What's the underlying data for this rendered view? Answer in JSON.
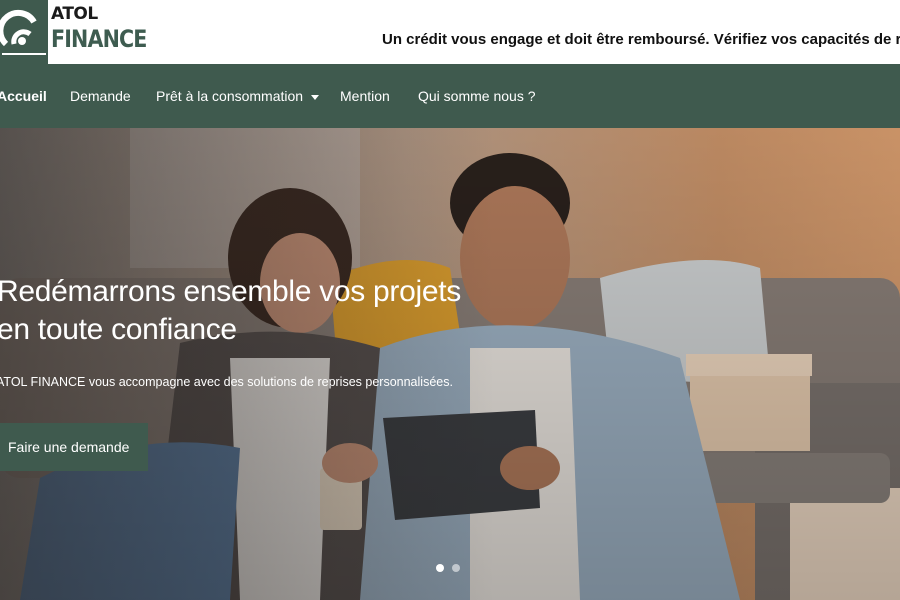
{
  "brand": {
    "line1": "ATOL",
    "line2": "FINANCE",
    "accent": "#3e5c50"
  },
  "header": {
    "notice": "Un crédit vous engage et doit être remboursé. Vérifiez vos capacités de re"
  },
  "nav": {
    "background": "#3f5a4e",
    "items": [
      {
        "label": "Accueil",
        "active": true
      },
      {
        "label": "Demande"
      },
      {
        "label": "Prêt à la consommation",
        "dropdown": true
      },
      {
        "label": "Mention"
      },
      {
        "label": "Qui somme nous ?"
      }
    ]
  },
  "hero": {
    "title": "Redémarrons ensemble vos projets en toute confiance",
    "subtitle": "ATOL FINANCE vous accompagne avec des solutions de reprises personnalisées.",
    "cta_label": "Faire une demande",
    "slides_total": 2,
    "slide_active": 1
  }
}
